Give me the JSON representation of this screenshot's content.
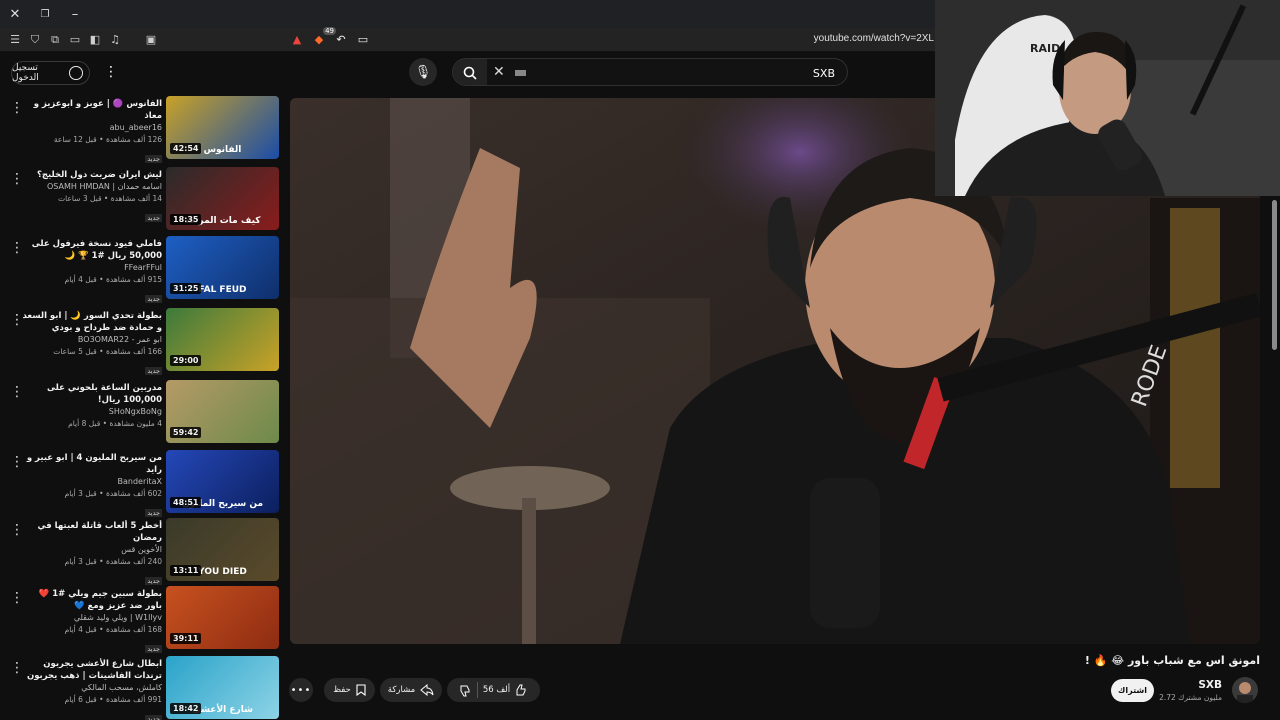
{
  "browser": {
    "url": "youtube.com/watch?v=2XL",
    "extension_badge": "49",
    "icons": [
      "close-icon",
      "restore-icon",
      "minimize-icon",
      "menu-icon",
      "shield-icon",
      "extensions-icon",
      "tabs-icon",
      "sidebar-icon",
      "music-icon",
      "wallet-icon"
    ]
  },
  "header": {
    "signin_label": "تسجيل الدخول",
    "search_value": "SXB"
  },
  "sidebar": {
    "items": [
      {
        "title": "الفانوس 🟣 | عوبز و ابوعزيز و معاذ",
        "channel": "abu_abeer16",
        "meta": "126 ألف مشاهدة • قبل 12 ساعة",
        "badge": "جديد",
        "duration": "42:54",
        "thumb_text": "الفانوس",
        "colors": [
          "#c9a227",
          "#1a4da8"
        ]
      },
      {
        "title": "ليش ايران ضربت دول الخليج؟",
        "channel": "اسامه حمدان | OSAMH HMDAN",
        "meta": "14 ألف مشاهدة • قبل 3 ساعات",
        "badge": "جديد",
        "duration": "18:35",
        "thumb_text": "كيف مات المرشد",
        "colors": [
          "#2b2b2b",
          "#8a1c1c"
        ]
      },
      {
        "title": "فاملي فيود نسخة فيرفول على 50,000 ريال #1 🏆 🌙",
        "channel": "FFearFFul",
        "meta": "915 ألف مشاهدة • قبل 4 أيام",
        "badge": "جديد",
        "duration": "31:25",
        "thumb_text": "FAL FEUD",
        "colors": [
          "#1e5fc4",
          "#0f2f6b"
        ]
      },
      {
        "title": "بطولة تحدي السور 🌙 | ابو السعد و حمادة ضد طرداح و بودي",
        "channel": "ابو عمر - BO3OMAR22",
        "meta": "166 ألف مشاهدة • قبل 5 ساعات",
        "badge": "جديد",
        "duration": "29:00",
        "thumb_text": "",
        "colors": [
          "#3c7a3c",
          "#c9a227"
        ]
      },
      {
        "title": "مدربين الساعة بلحوني على 100,000 ريال!",
        "channel": "SHoNgxBoNg",
        "meta": "4 مليون مشاهدة • قبل 8 أيام",
        "badge": "",
        "duration": "59:42",
        "thumb_text": "",
        "colors": [
          "#b59a66",
          "#6d8a4b"
        ]
      },
      {
        "title": "من سيربح المليون 4 | ابو عبير و رايد",
        "channel": "BanderitaX",
        "meta": "602 ألف مشاهدة • قبل 3 أيام",
        "badge": "جديد",
        "duration": "48:51",
        "thumb_text": "من سيربح المليون",
        "colors": [
          "#2448b8",
          "#0c1f5e"
        ]
      },
      {
        "title": "أخطر 5 ألعاب قاتلة لعبتها في رمضان",
        "channel": "الأخوين قس",
        "meta": "240 ألف مشاهدة • قبل 3 أيام",
        "badge": "جديد",
        "duration": "13:11",
        "thumb_text": "YOU DIED",
        "colors": [
          "#3a3a2a",
          "#5a4a2a"
        ]
      },
      {
        "title": "بطولة سبين جيم وبلي #1 ❤️ باور ضد عزيز ومع 💙",
        "channel": "W1llyv | ويلي وليد شقلي",
        "meta": "168 ألف مشاهدة • قبل 4 أيام",
        "badge": "جديد",
        "duration": "39:11",
        "thumb_text": "",
        "colors": [
          "#c7511f",
          "#8e2c12"
        ]
      },
      {
        "title": "ابطال شارع الأعشى يجربون ترندات الفاشينات | ذهب يجربون",
        "channel": "كاملش، مسحب المالكي",
        "meta": "991 ألف مشاهدة • قبل 6 أيام",
        "badge": "جديد",
        "duration": "18:42",
        "thumb_text": "شارع الأعشى",
        "colors": [
          "#2aa3c9",
          "#8dd3e6"
        ]
      }
    ]
  },
  "video": {
    "title": "امونق اس مع شباب باور 😂 🔥 !",
    "channel_name": "SXB",
    "subscribers": "2.72 مليون مشترك",
    "subscribe_label": "اشتراك",
    "likes": "56 ألف",
    "share_label": "مشاركة",
    "save_label": "حفظ"
  },
  "colors": {
    "background": "#0f0f0f",
    "chip": "#272727",
    "subscribe_bg": "#f1f1f1"
  }
}
